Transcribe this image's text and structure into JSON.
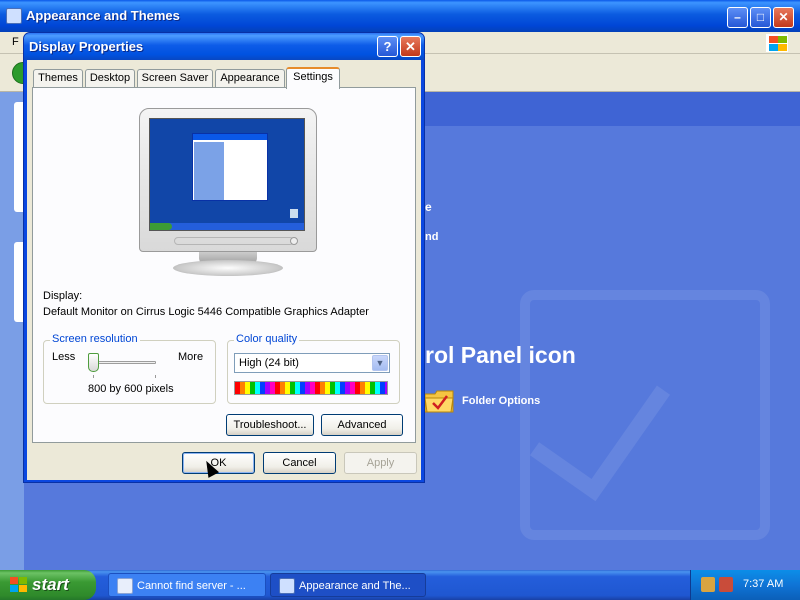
{
  "background_window": {
    "title": "Appearance and Themes",
    "menu_first_letter": "F",
    "heading_fragment": "rol Panel icon",
    "text_fragment_1": "e",
    "text_fragment_2": "nd",
    "folder_options_label": "Folder Options"
  },
  "dialog": {
    "title": "Display Properties",
    "help_glyph": "?",
    "close_glyph": "✕",
    "tabs": [
      {
        "label": "Themes"
      },
      {
        "label": "Desktop"
      },
      {
        "label": "Screen Saver"
      },
      {
        "label": "Appearance"
      },
      {
        "label": "Settings",
        "active": true
      }
    ],
    "display_label": "Display:",
    "display_value": "Default Monitor on Cirrus Logic 5446 Compatible Graphics Adapter",
    "screen_resolution": {
      "legend": "Screen resolution",
      "less_label": "Less",
      "more_label": "More",
      "value": "800 by 600 pixels",
      "slider_position": 0
    },
    "color_quality": {
      "legend": "Color quality",
      "selected": "High (24 bit)"
    },
    "troubleshoot_button": "Troubleshoot...",
    "advanced_button": "Advanced",
    "ok_button": "OK",
    "cancel_button": "Cancel",
    "apply_button": "Apply"
  },
  "taskbar": {
    "start_label": "start",
    "tasks": [
      {
        "label": "Cannot find server - ..."
      },
      {
        "label": "Appearance and The..."
      }
    ],
    "clock": "7:37 AM"
  },
  "colors": {
    "xp_blue": "#0a58e8",
    "dialog_face": "#ece9d8",
    "active_tab_accent": "#e68b2c",
    "start_green": "#3c9b35",
    "group_legend_blue": "#0046d5"
  }
}
